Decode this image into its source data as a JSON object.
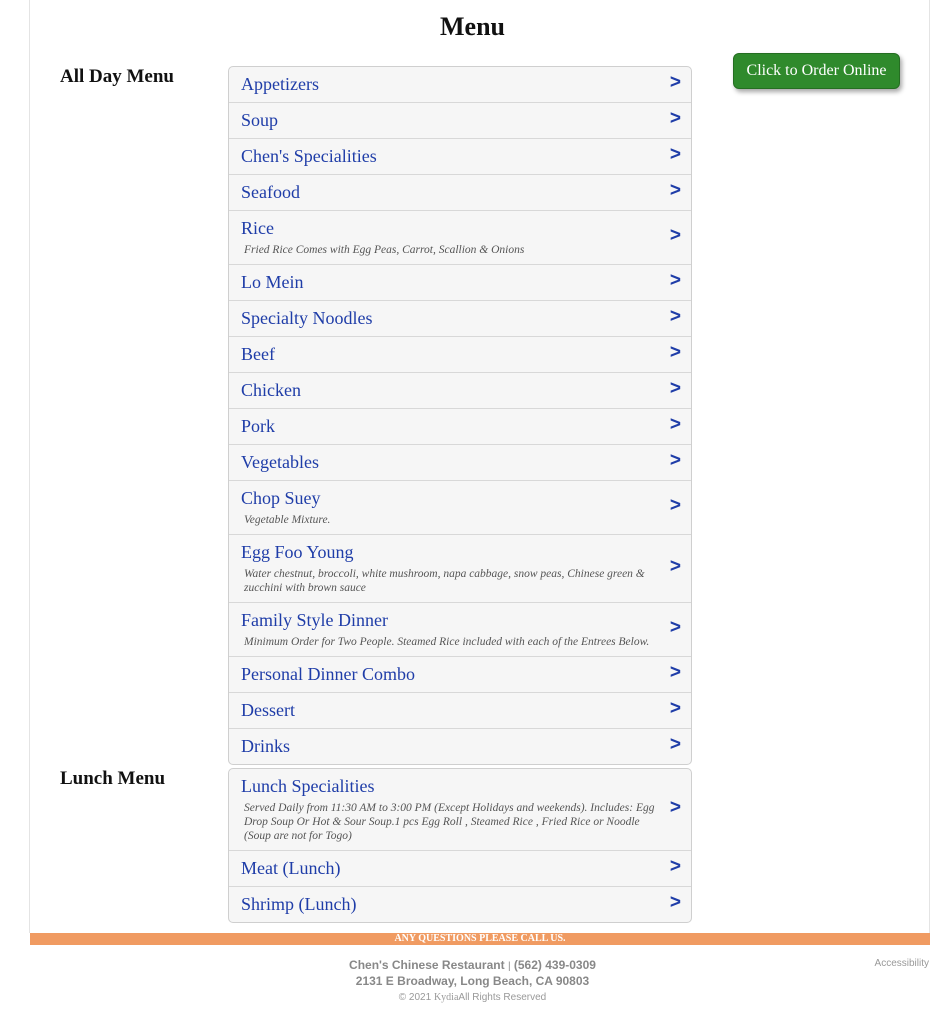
{
  "page": {
    "title": "Menu"
  },
  "order_button": {
    "label": "Click to Order Online"
  },
  "all_day": {
    "title": "All Day Menu",
    "items": [
      {
        "name": "Appetizers",
        "desc": ""
      },
      {
        "name": "Soup",
        "desc": ""
      },
      {
        "name": "Chen's Specialities",
        "desc": ""
      },
      {
        "name": "Seafood",
        "desc": ""
      },
      {
        "name": "Rice",
        "desc": "Fried Rice Comes with Egg Peas, Carrot, Scallion & Onions"
      },
      {
        "name": "Lo Mein",
        "desc": ""
      },
      {
        "name": "Specialty Noodles",
        "desc": ""
      },
      {
        "name": "Beef",
        "desc": ""
      },
      {
        "name": "Chicken",
        "desc": ""
      },
      {
        "name": "Pork",
        "desc": ""
      },
      {
        "name": "Vegetables",
        "desc": ""
      },
      {
        "name": "Chop Suey",
        "desc": "Vegetable Mixture."
      },
      {
        "name": "Egg Foo Young",
        "desc": "Water chestnut, broccoli, white mushroom, napa cabbage, snow peas, Chinese green & zucchini with brown sauce"
      },
      {
        "name": "Family Style Dinner",
        "desc": "Minimum Order for Two People. Steamed Rice included with each of the Entrees Below."
      },
      {
        "name": "Personal Dinner Combo",
        "desc": ""
      },
      {
        "name": "Dessert",
        "desc": ""
      },
      {
        "name": "Drinks",
        "desc": ""
      }
    ]
  },
  "lunch": {
    "title": "Lunch Menu",
    "items": [
      {
        "name": "Lunch Specialities",
        "desc": "Served Daily from 11:30 AM to 3:00 PM (Except Holidays and weekends). Includes: Egg Drop Soup Or Hot & Sour Soup.1 pcs Egg Roll , Steamed Rice , Fried Rice or Noodle (Soup are not for Togo)"
      },
      {
        "name": "Meat (Lunch)",
        "desc": ""
      },
      {
        "name": "Shrimp (Lunch)",
        "desc": ""
      }
    ]
  },
  "arrow_glyph": ">",
  "call_bar": {
    "text": "ANY QUESTIONS PLEASE CALL US."
  },
  "footer": {
    "restaurant": "Chen's Chinese Restaurant",
    "separator": "|",
    "phone": "(562) 439-0309",
    "address": "2131 E Broadway, Long Beach, CA 90803",
    "copyright": "© 2021",
    "kydia": "Kydia",
    "rights": "All Rights Reserved",
    "accessibility": "Accessibility"
  },
  "colors": {
    "link": "#1f3da8",
    "order_button": "#2f8a2c",
    "call_bar": "#f09b62"
  }
}
